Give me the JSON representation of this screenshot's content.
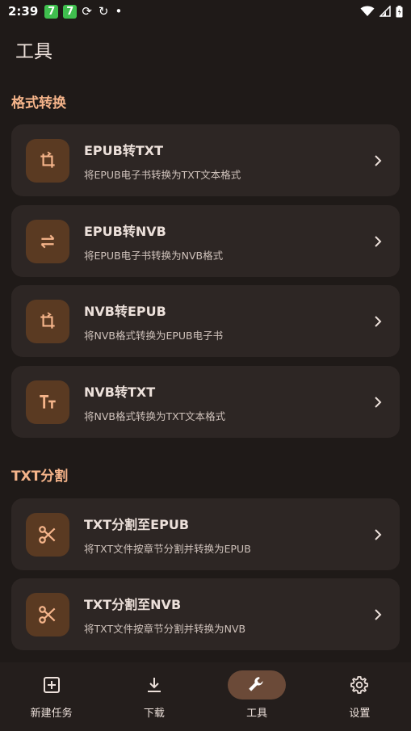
{
  "status_bar": {
    "time": "2:39",
    "badges": [
      "7",
      "7"
    ]
  },
  "page": {
    "title": "工具"
  },
  "sections": [
    {
      "title": "格式转换",
      "items": [
        {
          "title": "EPUB转TXT",
          "subtitle": "将EPUB电子书转换为TXT文本格式",
          "icon": "crop-rotate-icon"
        },
        {
          "title": "EPUB转NVB",
          "subtitle": "将EPUB电子书转换为NVB格式",
          "icon": "swap-arrows-icon"
        },
        {
          "title": "NVB转EPUB",
          "subtitle": "将NVB格式转换为EPUB电子书",
          "icon": "crop-rotate-icon"
        },
        {
          "title": "NVB转TXT",
          "subtitle": "将NVB格式转换为TXT文本格式",
          "icon": "text-size-icon"
        }
      ]
    },
    {
      "title": "TXT分割",
      "items": [
        {
          "title": "TXT分割至EPUB",
          "subtitle": "将TXT文件按章节分割并转换为EPUB",
          "icon": "scissors-icon"
        },
        {
          "title": "TXT分割至NVB",
          "subtitle": "将TXT文件按章节分割并转换为NVB",
          "icon": "scissors-icon"
        }
      ]
    }
  ],
  "bottom_nav": [
    {
      "label": "新建任务",
      "icon": "add-box-icon",
      "active": false
    },
    {
      "label": "下载",
      "icon": "download-icon",
      "active": false
    },
    {
      "label": "工具",
      "icon": "wrench-icon",
      "active": true
    },
    {
      "label": "设置",
      "icon": "gear-icon",
      "active": false
    }
  ],
  "colors": {
    "background": "#1f1a18",
    "card": "#2d2624",
    "icon_tile": "#5a3a22",
    "icon": "#f5b48a",
    "section_title": "#f5b48a",
    "nav_active_pill": "#6b4a38"
  }
}
